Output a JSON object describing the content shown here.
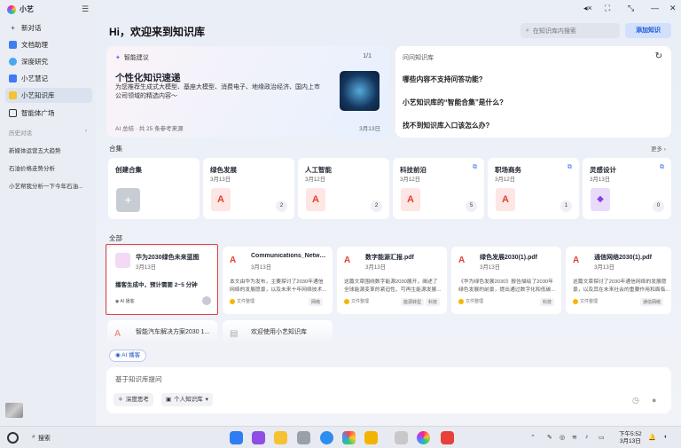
{
  "app": {
    "name": "小艺",
    "main_title": "Hi，欢迎来到知识库"
  },
  "sidebar": {
    "items": [
      {
        "label": "新对话",
        "icon": "plus-icon"
      },
      {
        "label": "文档助理",
        "icon": "document-icon"
      },
      {
        "label": "深度研究",
        "icon": "research-icon"
      },
      {
        "label": "小艺慧记",
        "icon": "note-icon"
      },
      {
        "label": "小艺知识库",
        "icon": "knowledge-icon"
      },
      {
        "label": "智能体广场",
        "icon": "agent-icon"
      }
    ],
    "history_label": "历史对话",
    "history": [
      "新媒体运营五大趋势",
      "石油价格走势分析",
      "小艺帮我分析一下今年石油..."
    ]
  },
  "header": {
    "search_placeholder": "在知识库内搜索",
    "add_button": "添加知识"
  },
  "recommend": {
    "tag": "智能建议",
    "page": "1/1",
    "title": "个性化知识速递",
    "desc": "为您推荐生成式大模型、基座大模型、消费电子、地缘政治经济、国内上市公司领域的精选内容～",
    "footer": "AI 总结 · 共 25 条参考来源",
    "date": "3月13日"
  },
  "qa": {
    "title": "问问知识库",
    "questions": [
      "哪些内容不支持问答功能?",
      "小艺知识库的“智能合集”是什么?",
      "找不到知识库入口该怎么办?"
    ]
  },
  "collections": {
    "label": "合集",
    "more": "更多",
    "create": "创建合集",
    "items": [
      {
        "name": "绿色发展",
        "date": "3月13日",
        "count": "2"
      },
      {
        "name": "人工智能",
        "date": "3月12日",
        "count": "2"
      },
      {
        "name": "科技前沿",
        "date": "3月12日",
        "count": "5"
      },
      {
        "name": "职场商务",
        "date": "3月12日",
        "count": "1"
      },
      {
        "name": "灵感设计",
        "date": "3月13日",
        "count": "0"
      }
    ]
  },
  "all": {
    "label": "全部",
    "generating": {
      "name": "华为2030绿色未来蓝图",
      "date": "3月13日",
      "status": "播客生成中，预计需要 2~5 分钟",
      "ai": "AI 播客"
    },
    "docs": [
      {
        "name": "Communications_Networ...",
        "date": "3月13日",
        "desc": "本文由华为发布，主要探讨了2030年通信网络的发展愿景，以及未来十年网络技术...",
        "source": "文件整理",
        "tags": [
          "网络"
        ]
      },
      {
        "name": "数字能源汇报.pdf",
        "date": "3月13日",
        "desc": "这篇文章围绕数字能源2030展开，阐述了全球能源变革的紧迫性、可再生能源发展...",
        "source": "文件整理",
        "tags": [
          "能源转型",
          "科技"
        ]
      },
      {
        "name": "绿色发展2030(1).pdf",
        "date": "3月13日",
        "desc": "《华为绿色发展2030》报告描绘了2030年绿色发展的前景，提出通过数字化和低碳...",
        "source": "文件整理",
        "tags": [
          "科技"
        ]
      },
      {
        "name": "通信网络2030(1).pdf",
        "date": "3月13日",
        "desc": "这篇文章探讨了2030年通信网络的发展愿景，以及其在未来社会的重要作用和面临...",
        "source": "文件整理",
        "tags": [
          "通信网络"
        ]
      }
    ],
    "more": [
      "智能汽车解决方案2030 1...",
      "欢迎使用小艺知识库"
    ]
  },
  "ai_chip": "AI 播客",
  "input": {
    "placeholder": "基于知识库提问",
    "chip_deep": "深度思考",
    "chip_kb": "个人知识库"
  },
  "taskbar": {
    "search": "搜索",
    "time": "下午5:52",
    "date": "3月13日"
  },
  "colors": {
    "accent": "#1a57d6",
    "pdf_red": "#e0402f",
    "highlight": "#e04040"
  }
}
